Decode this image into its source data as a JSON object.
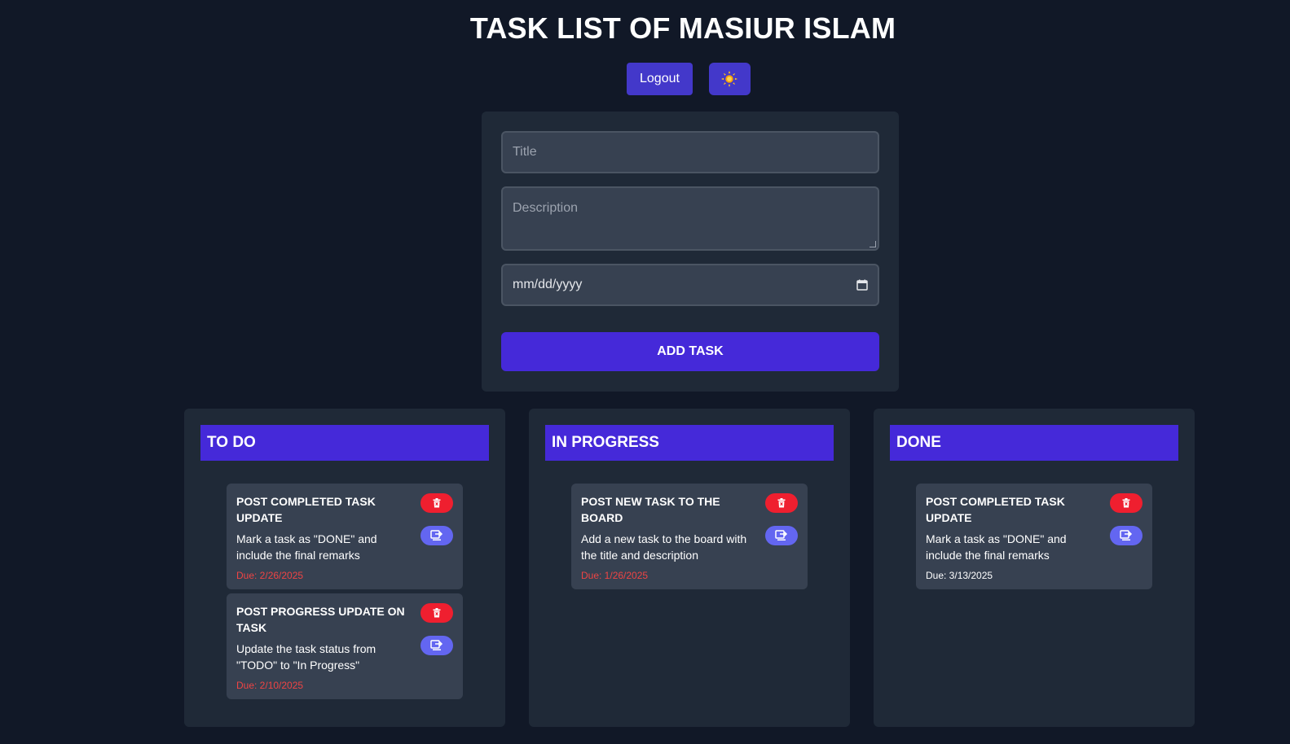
{
  "header": {
    "title": "TASK LIST OF MASIUR ISLAM",
    "logout_label": "Logout",
    "theme_icon": "sun-icon"
  },
  "form": {
    "title_placeholder": "Title",
    "description_placeholder": "Description",
    "date_placeholder": "mm/dd/yyyy",
    "add_label": "ADD TASK"
  },
  "colors": {
    "background": "#111827",
    "panel": "#1f2937",
    "card": "#374151",
    "accent": "#4529d9",
    "danger": "#ef1f2f",
    "move": "#6366f1",
    "overdue": "#ef4444"
  },
  "columns": [
    {
      "name": "TO DO",
      "tasks": [
        {
          "title": "POST COMPLETED TASK UPDATE",
          "description": "Mark a task as \"DONE\" and include the final remarks",
          "due": "Due: 2/26/2025"
        },
        {
          "title": "POST PROGRESS UPDATE ON TASK",
          "description": "Update the task status from \"TODO\" to \"In Progress\"",
          "due": "Due: 2/10/2025"
        }
      ]
    },
    {
      "name": "IN PROGRESS",
      "tasks": [
        {
          "title": "POST NEW TASK TO THE BOARD",
          "description": "Add a new task to the board with the title and description",
          "due": "Due: 1/26/2025"
        }
      ]
    },
    {
      "name": "DONE",
      "tasks": [
        {
          "title": "POST COMPLETED TASK UPDATE",
          "description": "Mark a task as \"DONE\" and include the final remarks",
          "due": "Due: 3/13/2025"
        }
      ]
    }
  ]
}
